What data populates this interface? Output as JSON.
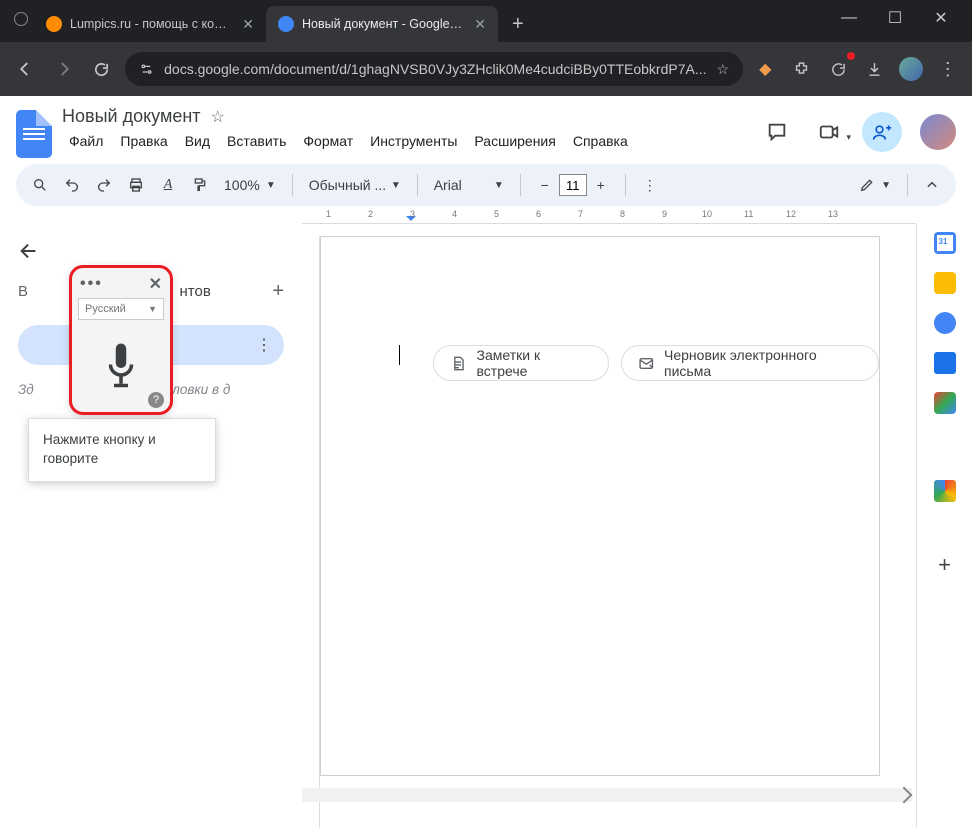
{
  "browser": {
    "tabs": [
      {
        "label": "Lumpics.ru - помощь с компью"
      },
      {
        "label": "Новый документ - Google Док"
      }
    ],
    "url": "docs.google.com/document/d/1ghagNVSB0VJy3ZHclik0Me4cudciBBy0TTEobkrdP7A..."
  },
  "doc": {
    "title": "Новый документ",
    "menu": [
      "Файл",
      "Правка",
      "Вид",
      "Вставить",
      "Формат",
      "Инструменты",
      "Расширения",
      "Справка"
    ]
  },
  "toolbar": {
    "zoom": "100%",
    "style": "Обычный ...",
    "font": "Arial",
    "size": "11"
  },
  "outline": {
    "partial_heading": "нтов",
    "hint_a": "Зд",
    "hint_b": "ны заголовки в д"
  },
  "chips": {
    "a": "Заметки к встрече",
    "b": "Черновик электронного письма"
  },
  "voice": {
    "lang": "Русский",
    "tooltip": "Нажмите кнопку и говорите"
  },
  "ruler": {
    "n1": "1",
    "n2": "2",
    "n3": "3",
    "n4": "4",
    "n5": "5",
    "n6": "6",
    "n7": "7",
    "n8": "8",
    "n9": "9",
    "n10": "10",
    "n11": "11",
    "n12": "12",
    "n13": "13"
  }
}
